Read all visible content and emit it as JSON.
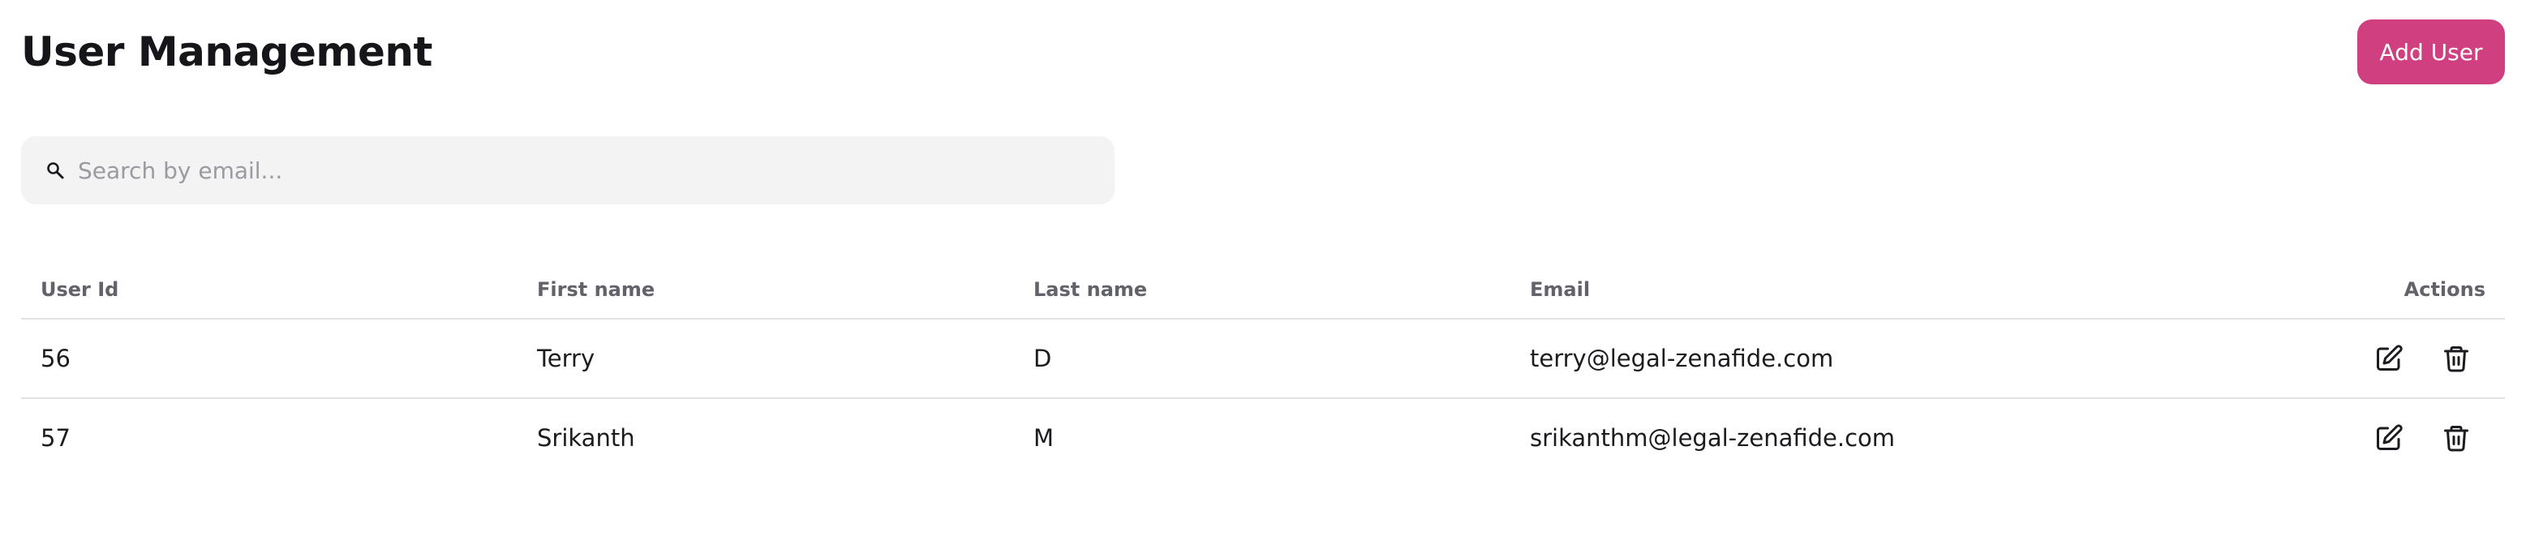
{
  "page": {
    "title": "User Management",
    "add_user_label": "Add User"
  },
  "search": {
    "icon": "search-icon",
    "placeholder": "Search by email...",
    "value": ""
  },
  "table": {
    "headers": {
      "user_id": "User Id",
      "first_name": "First name",
      "last_name": "Last name",
      "email": "Email",
      "actions": "Actions"
    },
    "rows": [
      {
        "user_id": "56",
        "first_name": "Terry",
        "last_name": "D",
        "email": "terry@legal-zenafide.com"
      },
      {
        "user_id": "57",
        "first_name": "Srikanth",
        "last_name": "M",
        "email": "srikanthm@legal-zenafide.com"
      }
    ],
    "row_actions": [
      "edit-icon",
      "trash-icon"
    ]
  },
  "colors": {
    "accent": "#d03f7f",
    "search_background": "#f3f3f3",
    "header_text": "#62626a",
    "divider": "#e2e2e2"
  }
}
